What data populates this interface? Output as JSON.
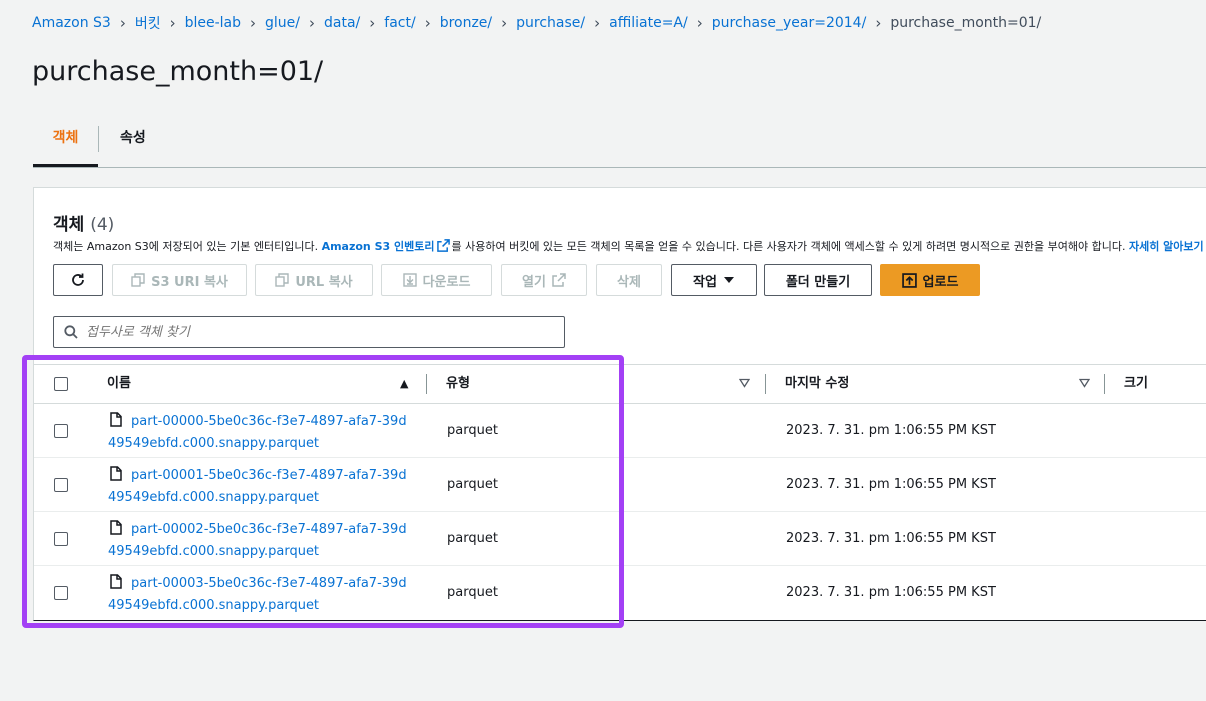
{
  "breadcrumbs": [
    "Amazon S3",
    "버킷",
    "blee-lab",
    "glue/",
    "data/",
    "fact/",
    "bronze/",
    "purchase/",
    "affiliate=A/",
    "purchase_year=2014/",
    "purchase_month=01/"
  ],
  "page_title": "purchase_month=01/",
  "tabs": {
    "objects": "객체",
    "properties": "속성"
  },
  "panel": {
    "title": "객체",
    "count": "(4)",
    "desc_before": "객체는 Amazon S3에 저장되어 있는 기본 엔터티입니다. ",
    "desc_link": "Amazon S3 인벤토리",
    "desc_after": "를 사용하여 버킷에 있는 모든 객체의 목록을 얻을 수 있습니다. 다른 사용자가 객체에 액세스할 수 있게 하려면 명시적으로 권한을 부여해야 합니다. ",
    "desc_more": "자세히 알아보기"
  },
  "toolbar": {
    "refresh_label": "",
    "copy_s3_uri": "S3 URI 복사",
    "copy_url": "URL 복사",
    "download": "다운로드",
    "open": "열기",
    "delete": "삭제",
    "actions": "작업",
    "create_folder": "폴더 만들기",
    "upload": "업로드"
  },
  "search": {
    "placeholder": "접두사로 객체 찾기"
  },
  "table": {
    "columns": {
      "name": "이름",
      "type": "유형",
      "modified": "마지막 수정",
      "size": "크기"
    },
    "rows": [
      {
        "name": "part-00000-5be0c36c-f3e7-4897-afa7-39d49549ebfd.c000.snappy.parquet",
        "type": "parquet",
        "modified": "2023. 7. 31. pm 1:06:55 PM KST"
      },
      {
        "name": "part-00001-5be0c36c-f3e7-4897-afa7-39d49549ebfd.c000.snappy.parquet",
        "type": "parquet",
        "modified": "2023. 7. 31. pm 1:06:55 PM KST"
      },
      {
        "name": "part-00002-5be0c36c-f3e7-4897-afa7-39d49549ebfd.c000.snappy.parquet",
        "type": "parquet",
        "modified": "2023. 7. 31. pm 1:06:55 PM KST"
      },
      {
        "name": "part-00003-5be0c36c-f3e7-4897-afa7-39d49549ebfd.c000.snappy.parquet",
        "type": "parquet",
        "modified": "2023. 7. 31. pm 1:06:55 PM KST"
      }
    ]
  },
  "colors": {
    "accent": "#ec7211",
    "link": "#0972d3",
    "upload": "#ec9a23",
    "highlight": "#a340f5"
  }
}
